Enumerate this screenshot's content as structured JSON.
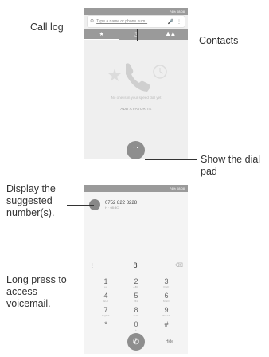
{
  "callouts": {
    "call_log": "Call log",
    "contacts": "Contacts",
    "show_dial_pad": "Show the dial pad",
    "display_suggested": "Display the suggested number(s).",
    "long_press": "Long press to access voicemail."
  },
  "screen1": {
    "status_time": "08:08",
    "status_battery": "74%",
    "search_placeholder": "Type a name or phone num..",
    "tabs": [
      {
        "icon": "star-icon"
      },
      {
        "icon": "clock-icon"
      },
      {
        "icon": "people-icon"
      }
    ],
    "empty_message": "No one is in your speed dial yet",
    "add_favorite": "ADD A FAVORITE"
  },
  "screen2": {
    "status_time": "08:08",
    "status_battery": "74%",
    "suggestion_number": "0752 822 8228",
    "suggestion_sub": "H · 08:3C",
    "typed_number": "8",
    "keys": [
      {
        "d": "1",
        "l": "oo"
      },
      {
        "d": "2",
        "l": "ABC"
      },
      {
        "d": "3",
        "l": "DEF"
      },
      {
        "d": "4",
        "l": "GHI"
      },
      {
        "d": "5",
        "l": "JKL"
      },
      {
        "d": "6",
        "l": "MNO"
      },
      {
        "d": "7",
        "l": "PQRS"
      },
      {
        "d": "8",
        "l": "TUV"
      },
      {
        "d": "9",
        "l": "WXYZ"
      },
      {
        "d": "*",
        "l": ""
      },
      {
        "d": "0",
        "l": "+"
      },
      {
        "d": "#",
        "l": ""
      }
    ],
    "hide_label": "Hide"
  }
}
